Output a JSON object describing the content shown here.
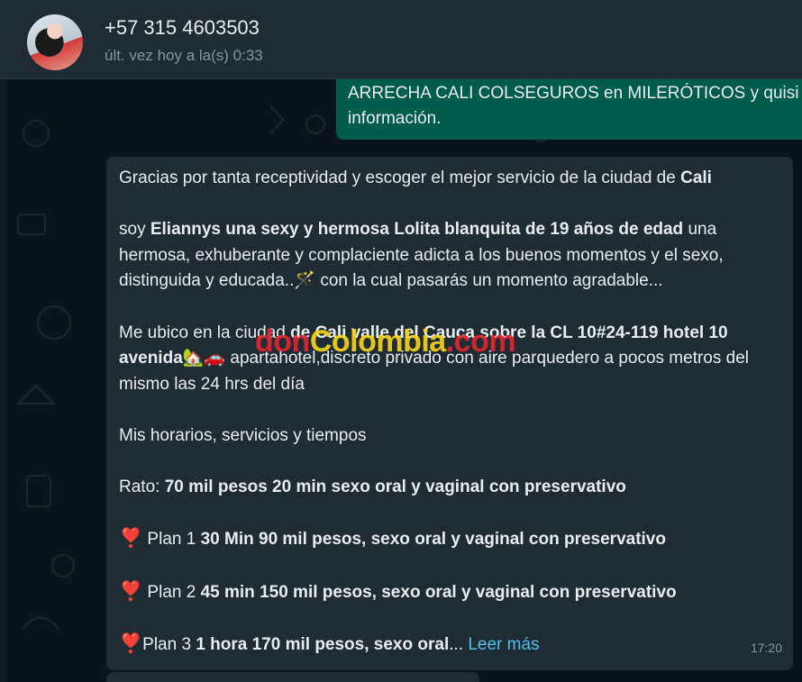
{
  "header": {
    "contact_name": "+57 315 4603503",
    "last_seen": "últ. vez hoy a la(s) 0:33"
  },
  "outgoing": {
    "line1": "ARRECHA CALI COLSEGUROS en MILERÓTICOS y quisi",
    "line2": "información."
  },
  "incoming": {
    "p1_text": "Gracias por tanta receptividad y escoger el mejor servicio de la ciudad de ",
    "p1_bold": "Cali",
    "p2_pre": " soy ",
    "p2_bold": "Eliannys una sexy y hermosa Lolita blanquita de 19 años de edad",
    "p2_post": " una hermosa,  exhuberante y complaciente adicta a los buenos momentos y el sexo, distinguida y educada..",
    "p2_emoji": "🪄",
    "p2_end": " con la cual pasarás un momento agradable...",
    "p3_pre": "Me ubico en la ciudad ",
    "p3_bold": "de Cali valle del Cauca sobre la CL 10#24-119 hotel 10 avenida",
    "p3_emoji": "🏡🚗",
    "p3_post": " apartahotel,discreto  privado con aire parquedero a pocos metros del mismo  las 24 hrs del día",
    "p4": "Mis horarios, servicios  y tiempos",
    "rato_label": "Rato: ",
    "rato_bold": "70 mil pesos 20 min sexo oral y vaginal con preservativo",
    "heart": "❣️",
    "plan1_label": " Plan 1 ",
    "plan1_bold": "30 Min 90 mil pesos, sexo oral y vaginal  con preservativo",
    "plan2_label": " Plan 2 ",
    "plan2_bold": "45 min 150 mil pesos, sexo oral y vaginal con preservativo",
    "plan3_label": "Plan 3 ",
    "plan3_bold": "1 hora 170 mil pesos, sexo oral",
    "ellipsis": "... ",
    "read_more": "Leer más",
    "time": "17:20"
  },
  "watermark": {
    "part1": "don",
    "part2": "Colombia",
    "part3": ".com"
  },
  "colors": {
    "header_bg": "#202c33",
    "chat_bg": "#0b141a",
    "outgoing_bubble": "#005c4b",
    "incoming_bubble": "#202c33",
    "link": "#53bdeb"
  }
}
